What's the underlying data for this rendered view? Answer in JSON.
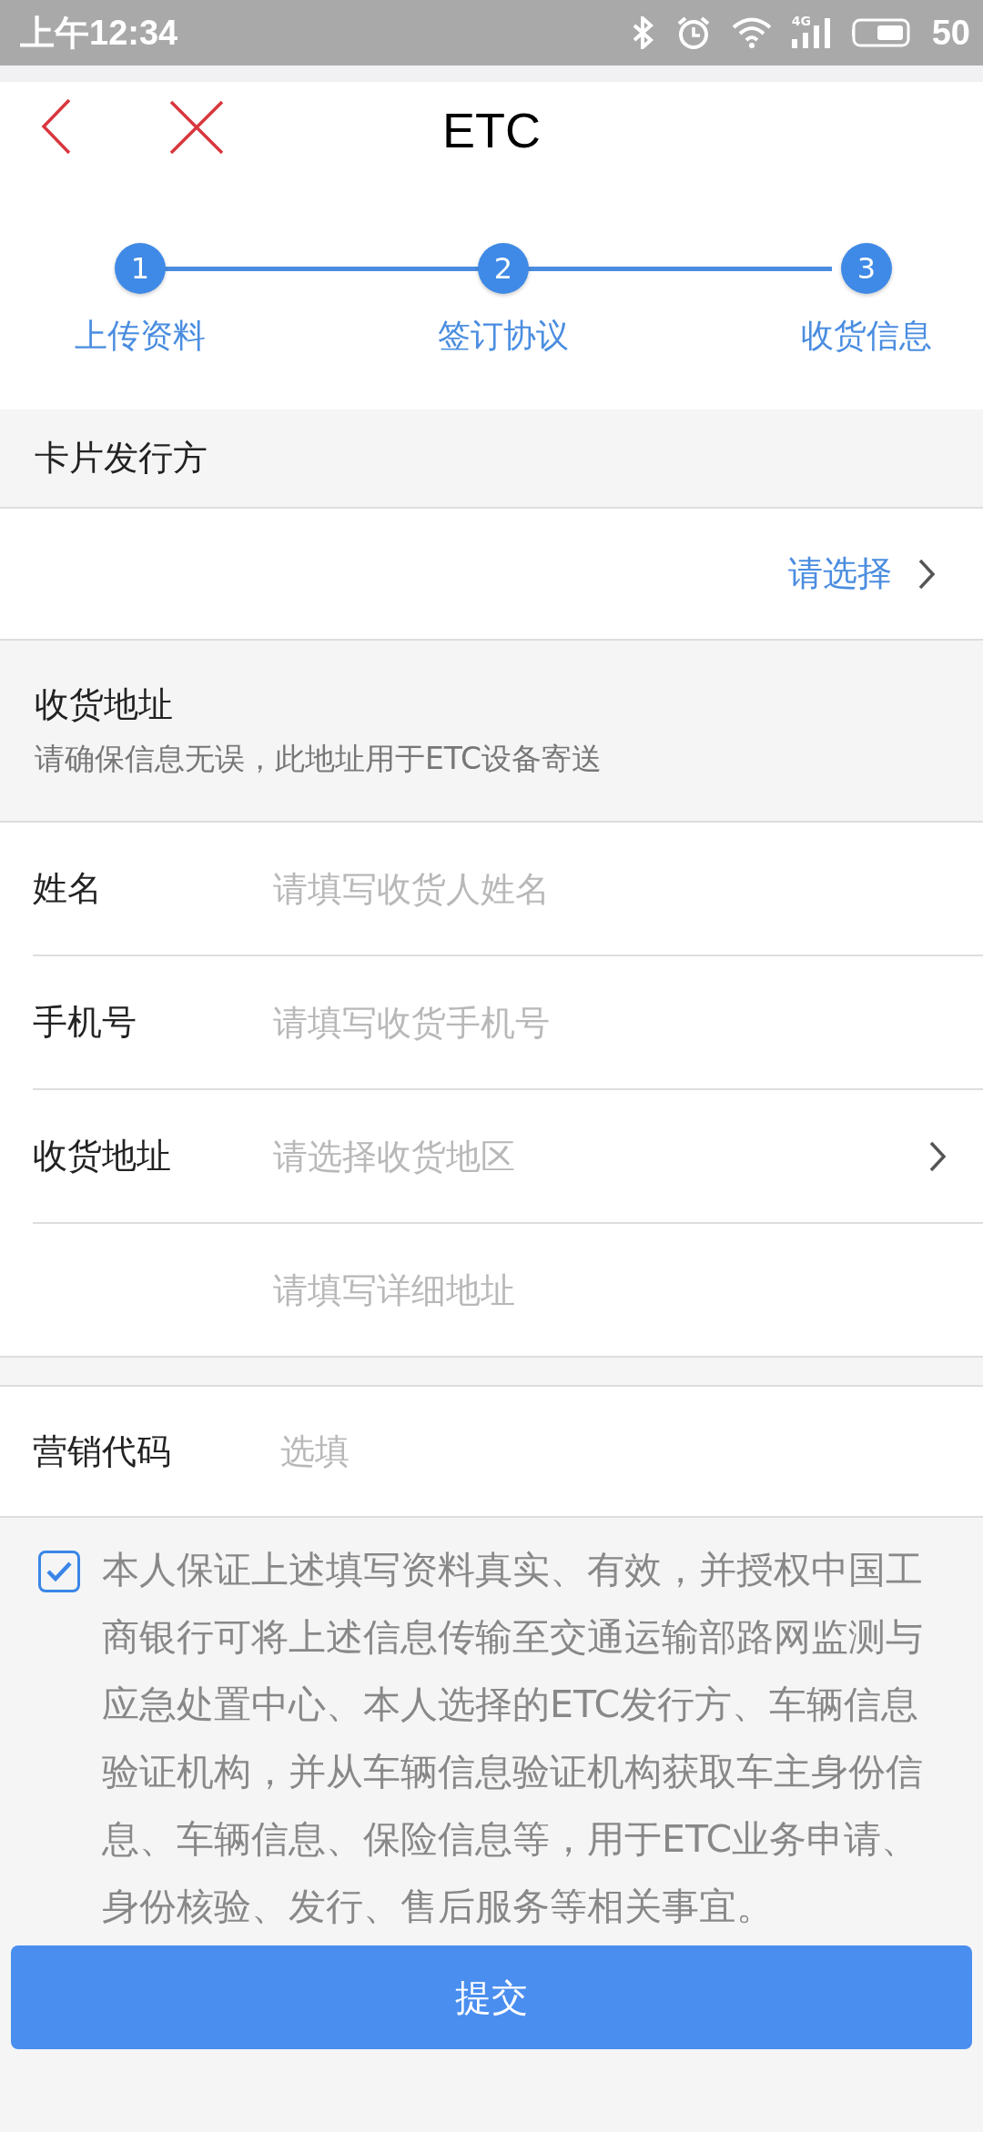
{
  "status_bar": {
    "time": "上午12:34",
    "network": "4G",
    "battery": "50"
  },
  "header": {
    "title": "ETC"
  },
  "steps": [
    {
      "number": "1",
      "label": "上传资料"
    },
    {
      "number": "2",
      "label": "签订协议"
    },
    {
      "number": "3",
      "label": "收货信息"
    }
  ],
  "issuer": {
    "heading": "卡片发行方",
    "placeholder": "请选择"
  },
  "address_section": {
    "heading": "收货地址",
    "note": "请确保信息无误，此地址用于ETC设备寄送"
  },
  "fields": [
    {
      "label": "姓名",
      "placeholder": "请填写收货人姓名",
      "kind": "text"
    },
    {
      "label": "手机号",
      "placeholder": "请填写收货手机号",
      "kind": "text"
    },
    {
      "label": "收货地址",
      "placeholder": "请选择收货地区",
      "kind": "select"
    },
    {
      "placeholder": "请填写详细地址",
      "kind": "text"
    }
  ],
  "marketing": {
    "label": "营销代码",
    "placeholder": "选填"
  },
  "agreement": {
    "checked": true,
    "text": "本人保证上述填写资料真实、有效，并授权中国工商银行可将上述信息传输至交通运输部路网监测与应急处置中心、本人选择的ETC发行方、车辆信息验证机构，并从车辆信息验证机构获取车主身份信息、车辆信息、保险信息等，用于ETC业务申请、身份核验、发行、售后服务等相关事宜。"
  },
  "submit_button": "提交"
}
